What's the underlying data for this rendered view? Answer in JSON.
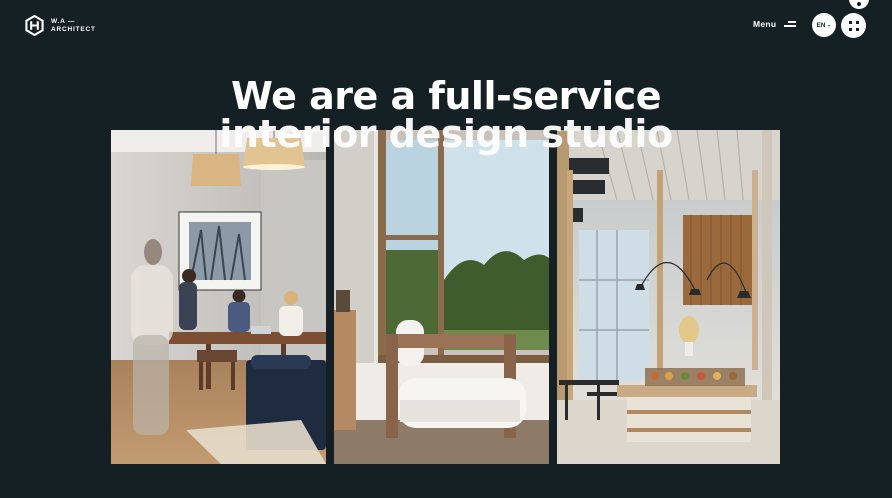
{
  "brand": {
    "name_line1": "W.A —",
    "name_line2": "ARCHITECT",
    "logo_icon": "hexagon-h-logo"
  },
  "header": {
    "menu_label": "Menu",
    "menu_icon": "hamburger-icon",
    "language": "EN",
    "language_icon": "chevron-down-icon",
    "grid_icon": "grid-dots-icon"
  },
  "hero": {
    "headline_line1": "We are a full-service",
    "headline_line2": "interior design studio"
  },
  "gallery": {
    "images": [
      "office-meeting-room",
      "lounge-chair-by-window",
      "restaurant-lobby"
    ]
  },
  "colors": {
    "background": "#142023",
    "text": "#ffffff"
  }
}
